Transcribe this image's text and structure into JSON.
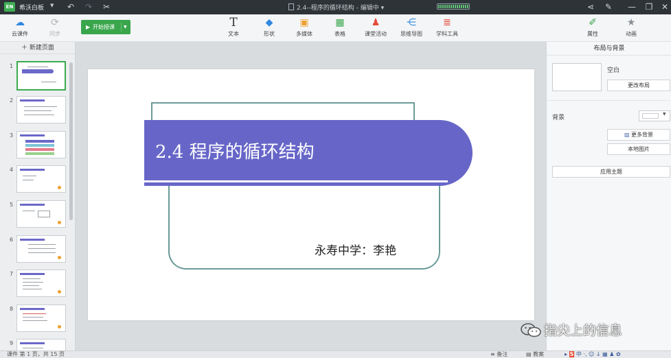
{
  "titlebar": {
    "app_logo": "EN",
    "app_name": "希沃白板",
    "document_title": "2.4--程序的循环结构 - 编辑中",
    "icons": [
      "undo-icon",
      "redo-icon",
      "cut-icon",
      "share-icon",
      "pen-icon",
      "minimize-icon",
      "restore-icon",
      "close-icon"
    ]
  },
  "toolbar": {
    "cloud_label": "云课件",
    "sync_label": "同步",
    "start_label": "开始授课",
    "text_label": "文本",
    "shape_label": "形状",
    "media_label": "多媒体",
    "table_label": "表格",
    "activity_label": "课堂活动",
    "mindmap_label": "思维导图",
    "subject_label": "学科工具",
    "props_label": "属性",
    "anim_label": "动画"
  },
  "left_pane": {
    "new_page_label": "新建页面",
    "thumbnails": [
      "1",
      "2",
      "3",
      "4",
      "5",
      "6",
      "7",
      "8",
      "9"
    ],
    "active_page": 1
  },
  "slide": {
    "title": "2.4  程序的循环结构",
    "author": "永寿中学：李艳"
  },
  "right_pane": {
    "title": "布局与背景",
    "layout_name": "空白",
    "change_layout_label": "更改布局",
    "background_label": "背景",
    "background_color": "#ffffff",
    "more_bg_label": "更多背景",
    "local_image_label": "本地图片",
    "apply_theme_label": "应用主题"
  },
  "statusbar": {
    "page_info": "课件 第 1 页，共 15 页",
    "notes_label": "备注",
    "teaching_label": "教案",
    "tray_text": "中 ·, ☺ ↓ ▦ ♟ ✿"
  },
  "watermark": {
    "text": "指尖上的信息"
  },
  "colors": {
    "accent_green": "#3aa64c",
    "banner_purple": "#6766c8",
    "frame_teal": "#6a9a98",
    "titlebar_dark": "#2e3338"
  }
}
